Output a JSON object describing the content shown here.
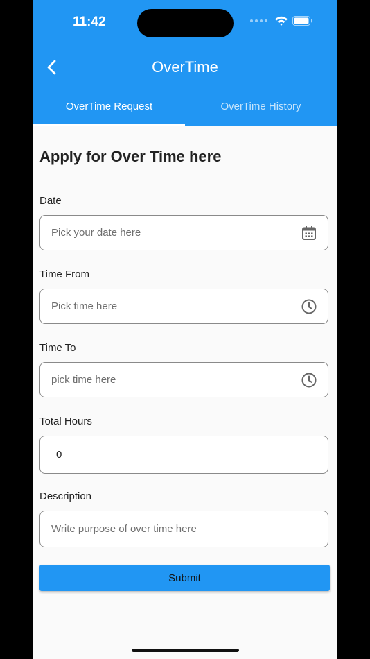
{
  "status_bar": {
    "time": "11:42"
  },
  "app_bar": {
    "title": "OverTime"
  },
  "tabs": [
    {
      "label": "OverTime Request",
      "active": true
    },
    {
      "label": "OverTime History",
      "active": false
    }
  ],
  "form": {
    "heading": "Apply for Over Time here",
    "date": {
      "label": "Date",
      "placeholder": "Pick your date here",
      "icon": "calendar-icon"
    },
    "time_from": {
      "label": "Time From",
      "placeholder": "Pick time here",
      "icon": "clock-icon"
    },
    "time_to": {
      "label": "Time To",
      "placeholder": "pick time here",
      "icon": "clock-icon"
    },
    "total_hours": {
      "label": "Total Hours",
      "value": "0"
    },
    "description": {
      "label": "Description",
      "placeholder": "Write purpose of over time here"
    },
    "submit_label": "Submit"
  },
  "colors": {
    "primary": "#2196f3",
    "background": "#fafafa"
  }
}
